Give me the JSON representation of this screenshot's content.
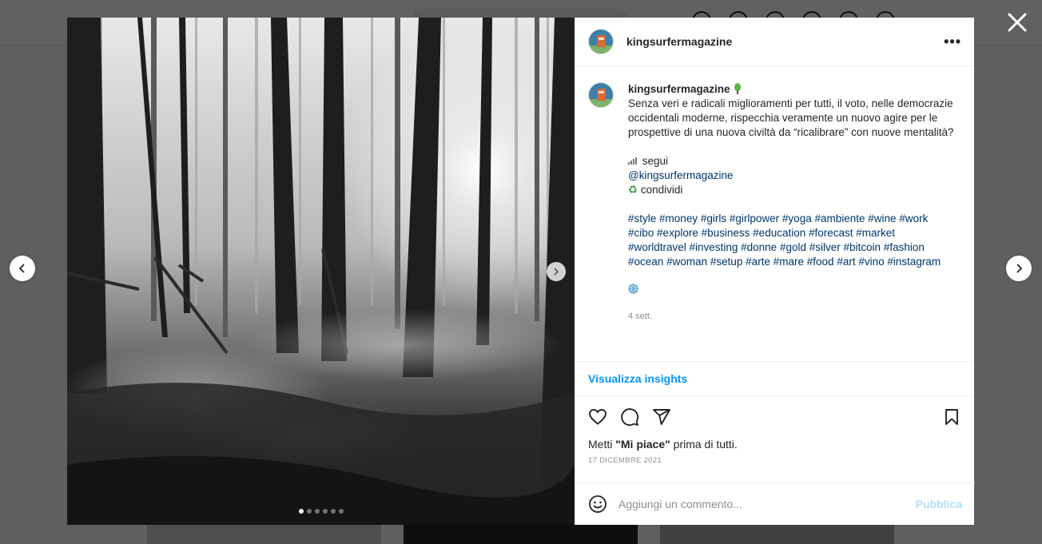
{
  "post": {
    "username": "kingsurfermagazine",
    "more_icon": "more-horizontal-icon",
    "caption_lines": [
      "Senza veri e radicali miglioramenti per tutti, il voto, nelle democrazie",
      "occidentali moderne, rispecchia veramente un nuovo agire per le",
      "prospettive di una nuova civiltà da “ricalibrare” con nuove mentalità?"
    ],
    "follow_label": "segui",
    "mention": "@kingsurfermagazine",
    "share_label": "condividi",
    "hashtags": [
      [
        "#style",
        "#money",
        "#girls",
        "#girlpower",
        "#yoga",
        "#ambiente",
        "#wine",
        "#work"
      ],
      [
        "#cibo",
        "#explore",
        "#business",
        "#education",
        "#forecast",
        "#market"
      ],
      [
        "#worldtravel",
        "#investing",
        "#donne",
        "#gold",
        "#silver",
        "#bitcoin",
        "#fashion"
      ],
      [
        "#ocean",
        "#woman",
        "#setup",
        "#arte",
        "#mare",
        "#food",
        "#art",
        "#vino",
        "#instagram"
      ]
    ],
    "time_ago": "4 sett.",
    "insights_label": "Visualizza insights",
    "likes_prefix": "Metti ",
    "likes_bold": "\"Mi piace\"",
    "likes_suffix": " prima di tutti.",
    "date": "17 DICEMBRE 2021",
    "comment_placeholder": "Aggiungi un commento...",
    "publish_label": "Pubblica"
  },
  "carousel": {
    "total": 6,
    "active_index": 0
  },
  "colors": {
    "link": "#00376b",
    "accent": "#0095f6",
    "publish_disabled": "#b2dffc",
    "muted": "#8e8e8e"
  }
}
